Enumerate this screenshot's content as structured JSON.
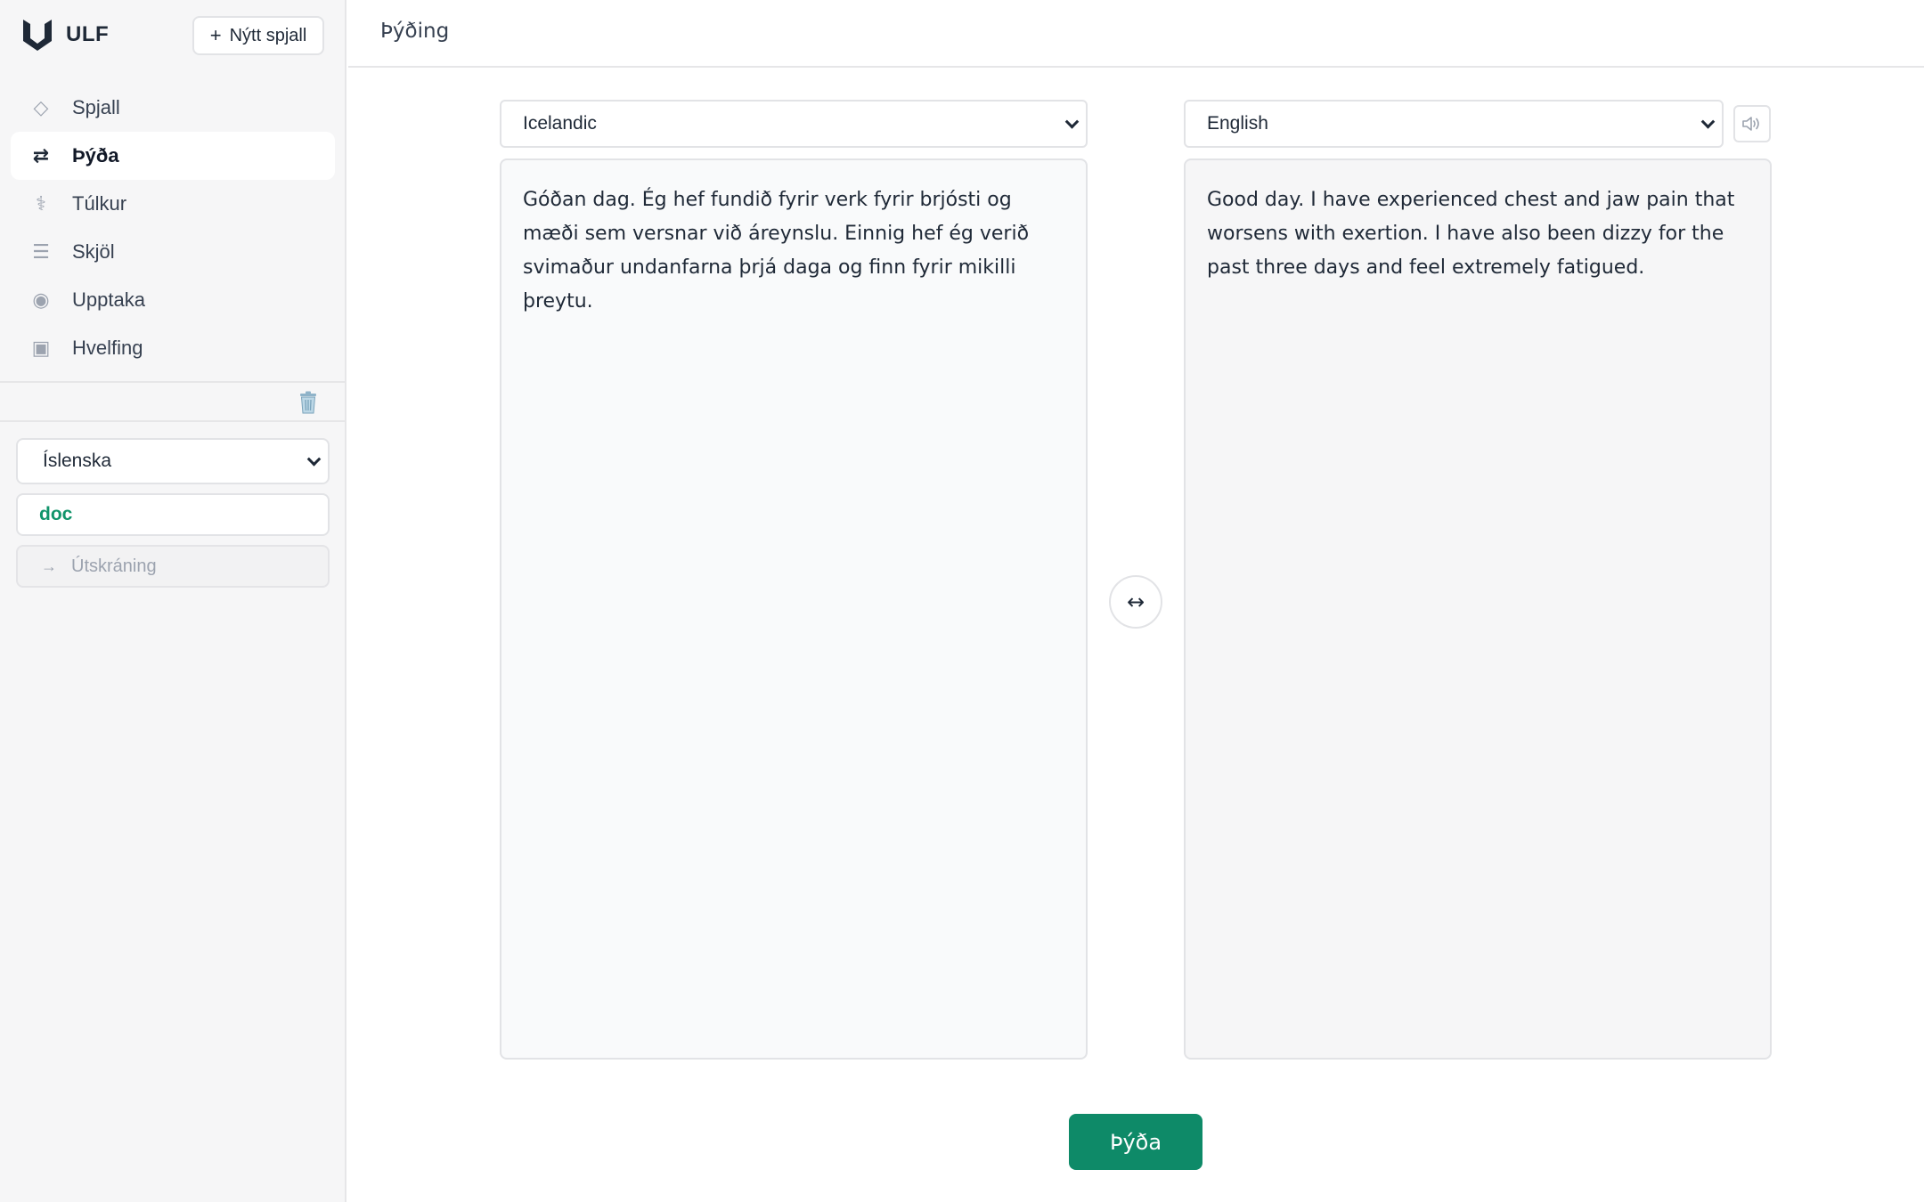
{
  "app": {
    "brand": "ULF",
    "new_chat_label": "Nýtt spjall"
  },
  "sidebar": {
    "items": [
      {
        "label": "Spjall",
        "icon": "diamond-icon",
        "glyph": "◇",
        "active": false
      },
      {
        "label": "Þýða",
        "icon": "swap-arrows-icon",
        "glyph": "⇄",
        "active": true
      },
      {
        "label": "Túlkur",
        "icon": "medical-icon",
        "glyph": "⚕",
        "active": false
      },
      {
        "label": "Skjöl",
        "icon": "lines-icon",
        "glyph": "☰",
        "active": false
      },
      {
        "label": "Upptaka",
        "icon": "record-icon",
        "glyph": "◉",
        "active": false
      },
      {
        "label": "Hvelfing",
        "icon": "vault-icon",
        "glyph": "▣",
        "active": false
      }
    ],
    "language_value": "Íslenska",
    "username": "doc",
    "logout_label": "Útskráning"
  },
  "header": {
    "title": "Þýðing"
  },
  "translator": {
    "source_language": "Icelandic",
    "target_language": "English",
    "source_text": "Góðan dag. Ég hef fundið fyrir verk fyrir brjósti og mæði sem versnar við áreynslu. Einnig hef ég verið svimaður undanfarna þrjá daga og finn fyrir mikilli þreytu.",
    "target_text": "Good day. I have experienced chest and jaw pain that worsens with exertion. I have also been dizzy for the past three days and feel extremely fatigued.",
    "swap_glyph": "↔",
    "translate_label": "Þýða"
  },
  "colors": {
    "accent": "#0e8a68",
    "username": "#11946b",
    "sidebar_bg": "#f6f6f7"
  }
}
